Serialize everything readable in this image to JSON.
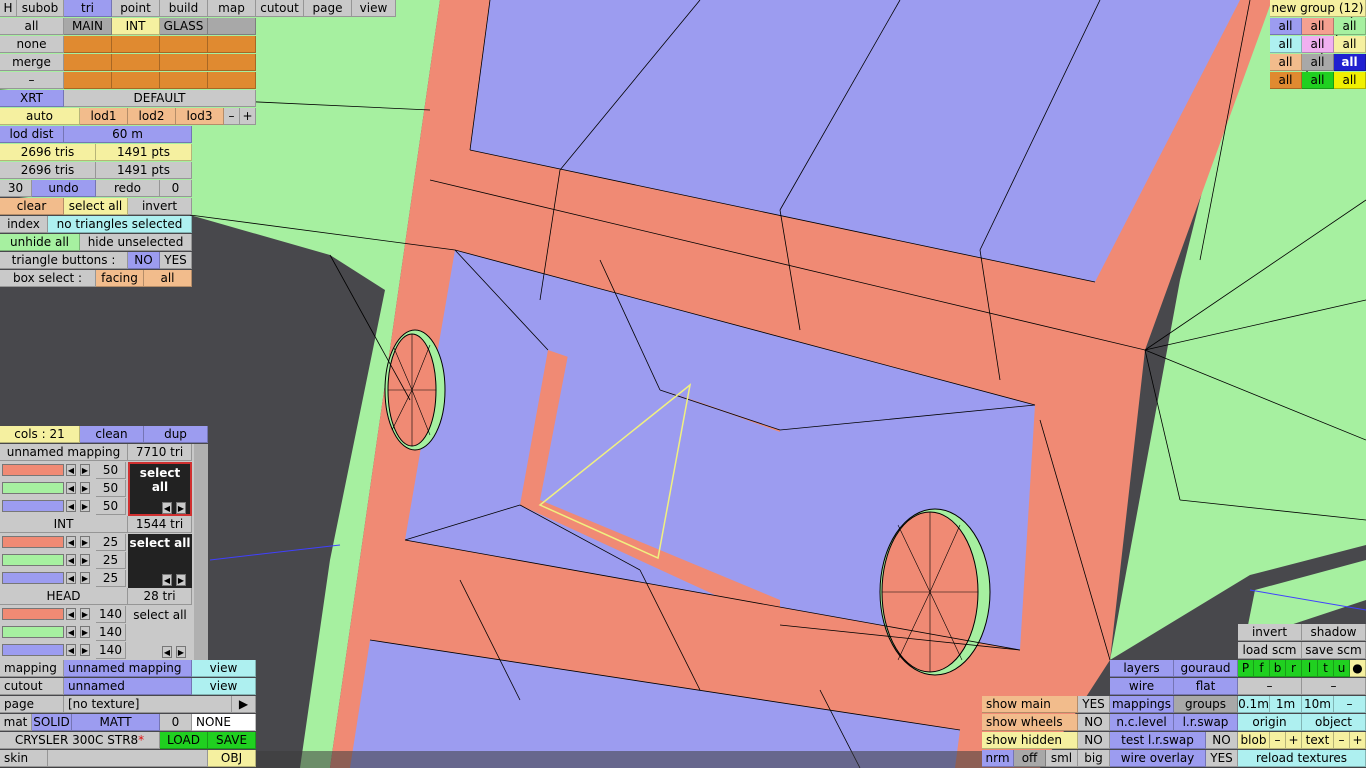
{
  "colors": {
    "green": "#a6f0a0",
    "salmon": "#f08a74",
    "lavender": "#9c9cf0",
    "dark": "#48484c",
    "yellowline": "#f0f080"
  },
  "topbar": {
    "h": "H",
    "subob": "subob",
    "tri": "tri",
    "point": "point",
    "build": "build",
    "map": "map",
    "cutout": "cutout",
    "page": "page",
    "view": "view"
  },
  "groups": {
    "all": "all",
    "main": "MAIN",
    "int": "INT",
    "glass": "GLASS"
  },
  "actions": {
    "none": "none",
    "merge": "merge",
    "dash": "–"
  },
  "shader": {
    "xrt": "XRT",
    "default": "DEFAULT"
  },
  "lod": {
    "auto": "auto",
    "lod1": "lod1",
    "lod2": "lod2",
    "lod3": "lod3",
    "minus": "–",
    "plus": "+",
    "dist_label": "lod dist",
    "dist_value": "60 m"
  },
  "counts": {
    "tris1": "2696 tris",
    "pts1": "1491 pts",
    "tris2": "2696 tris",
    "pts2": "1491 pts"
  },
  "history": {
    "n": "30",
    "undo": "undo",
    "redo": "redo",
    "zero": "0"
  },
  "selection": {
    "clear": "clear",
    "select_all": "select all",
    "invert": "invert",
    "index": "index",
    "status": "no triangles selected",
    "unhide_all": "unhide all",
    "hide_unselected": "hide unselected",
    "tri_buttons": "triangle buttons :",
    "no": "NO",
    "yes": "YES",
    "box_select": "box select :",
    "facing": "facing",
    "all": "all"
  },
  "cols": {
    "label": "cols : 21",
    "clean": "clean",
    "dup": "dup"
  },
  "mappings": [
    {
      "name": "unnamed mapping",
      "tri": "7710 tri",
      "v1": "50",
      "v2": "50",
      "v3": "50",
      "select": "select all"
    },
    {
      "name": "INT",
      "tri": "1544 tri",
      "v1": "25",
      "v2": "25",
      "v3": "25",
      "select": "select all"
    },
    {
      "name": "HEAD",
      "tri": "28 tri",
      "v1": "140",
      "v2": "140",
      "v3": "140",
      "select": "select all"
    }
  ],
  "bottom_left": {
    "mapping_label": "mapping",
    "mapping_value": "unnamed mapping",
    "view1": "view",
    "cutout_label": "cutout",
    "cutout_value": "unnamed",
    "view2": "view",
    "page_label": "page",
    "page_value": "[no texture]",
    "play": "▶",
    "mat": "mat",
    "solid": "SOLID",
    "matt": "MATT",
    "zero": "0",
    "none": "NONE",
    "model": "CRYSLER 300C STR8",
    "star": "*",
    "load": "LOAD",
    "save": "SAVE",
    "skin": "skin",
    "obj": "OBJ"
  },
  "new_group": {
    "title": "new group (12)",
    "all": "all"
  },
  "bottom_right": {
    "invert": "invert",
    "shadow": "shadow",
    "load_scm": "load scm",
    "save_scm": "save scm",
    "layers": "layers",
    "gouraud": "gouraud",
    "wire": "wire",
    "flat": "flat",
    "mappings": "mappings",
    "groups": "groups",
    "n_c_level": "n.c.level",
    "l_r_swap": "l.r.swap",
    "test_l_r_swap": "test l.r.swap",
    "no": "NO",
    "wire_overlay": "wire overlay",
    "yes": "YES",
    "show_main": "show main",
    "show_wheels": "show wheels",
    "show_hidden": "show hidden",
    "nrm": "nrm",
    "off": "off",
    "sml": "sml",
    "big": "big",
    "letters": [
      "P",
      "f",
      "b",
      "r",
      "l",
      "t",
      "u",
      "●"
    ],
    "dash": "–",
    "d01": "0.1m",
    "d1": "1m",
    "d10": "10m",
    "origin": "origin",
    "object": "object",
    "blob": "blob",
    "minus": "–",
    "plus": "+",
    "text": "text",
    "reload": "reload textures"
  }
}
